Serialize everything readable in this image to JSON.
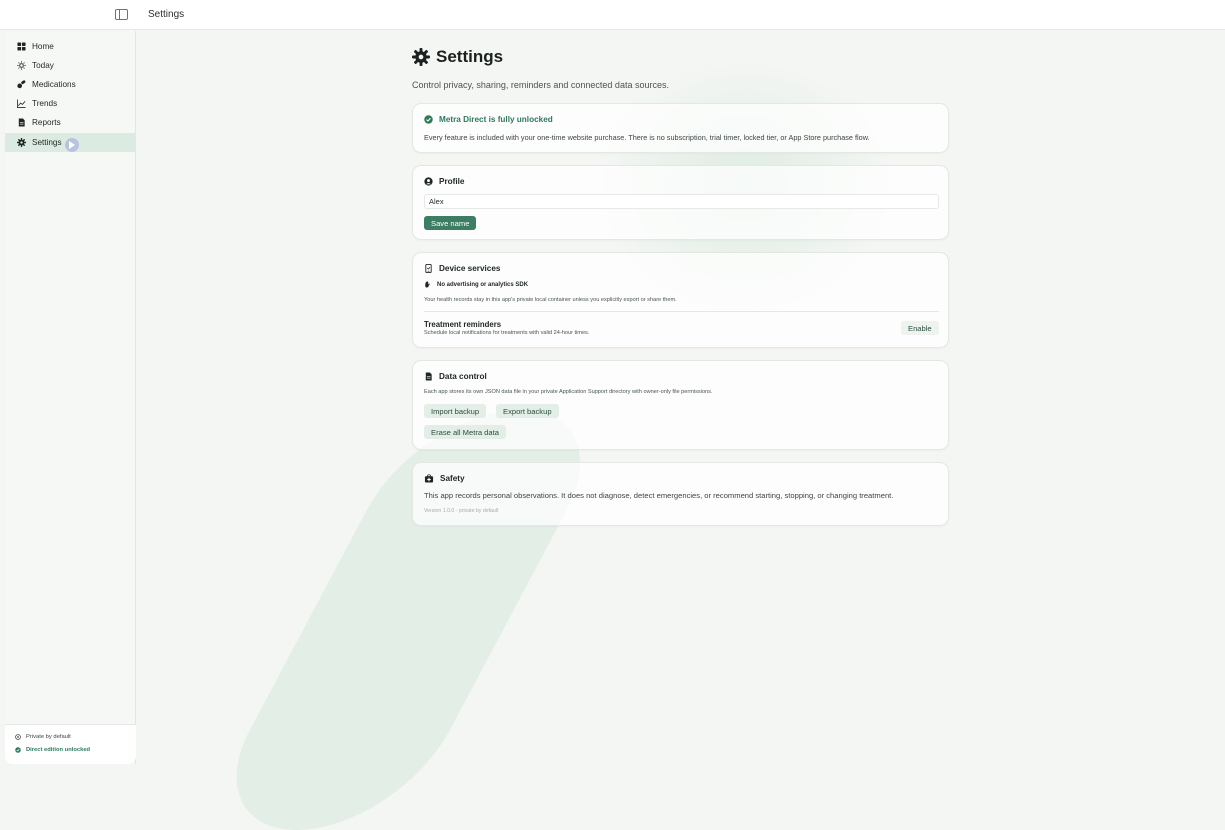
{
  "topbar": {
    "title": "Settings"
  },
  "sidebar": {
    "items": [
      {
        "label": "Home",
        "icon": "grid-icon"
      },
      {
        "label": "Today",
        "icon": "sun-icon"
      },
      {
        "label": "Medications",
        "icon": "pill-icon"
      },
      {
        "label": "Trends",
        "icon": "chart-line-icon"
      },
      {
        "label": "Reports",
        "icon": "document-icon"
      },
      {
        "label": "Settings",
        "icon": "gear-icon",
        "active": true
      }
    ],
    "footer": {
      "private": "Private by default",
      "unlocked": "Direct edition unlocked"
    }
  },
  "main": {
    "title": "Settings",
    "subtitle": "Control privacy, sharing, reminders and connected data sources.",
    "unlock_card": {
      "title": "Metra Direct is fully unlocked",
      "body": "Every feature is included with your one-time website purchase. There is no subscription, trial timer, locked tier, or App Store purchase flow."
    },
    "profile_card": {
      "title": "Profile",
      "name_value": "Alex",
      "save_label": "Save name"
    },
    "device_card": {
      "title": "Device services",
      "no_sdk": "No advertising or analytics SDK",
      "storage_note": "Your health records stay in this app's private local container unless you explicitly export or share them.",
      "reminders_title": "Treatment reminders",
      "reminders_body": "Schedule local notifications for treatments with valid 24-hour times.",
      "enable_label": "Enable"
    },
    "data_card": {
      "title": "Data control",
      "body": "Each app stores its own JSON data file in your private Application Support directory with owner-only file permissions.",
      "import_label": "Import backup",
      "export_label": "Export backup",
      "erase_label": "Erase all Metra data"
    },
    "safety_card": {
      "title": "Safety",
      "body": "This app records personal observations. It does not diagnose, detect emergencies, or recommend starting, stopping, or changing treatment.",
      "version": "Version 1.0.0 · private by default"
    }
  },
  "colors": {
    "accent": "#3d7d63",
    "accent_text": "#2e7a5a",
    "active_bg": "#dcebe2",
    "soft_button": "#e3eee7"
  }
}
